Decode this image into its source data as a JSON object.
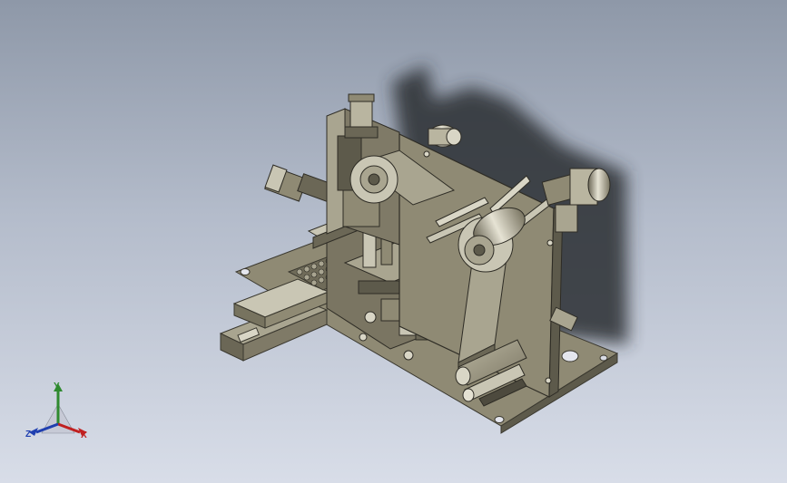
{
  "triad": {
    "x_label": "X",
    "y_label": "Y",
    "z_label": "Z",
    "x_color": "#c02020",
    "y_color": "#2f8a2f",
    "z_color": "#1f3fb0"
  },
  "colors": {
    "background_top": "#8e98a8",
    "background_bottom": "#d8dde8",
    "part_body": "#8f8a74",
    "part_light": "#c9c6b4",
    "part_dark": "#4d4a3e",
    "shadow": "#2b2d33"
  },
  "icons": {
    "model": "cad-assembly-icon",
    "triad": "axis-triad-icon"
  }
}
